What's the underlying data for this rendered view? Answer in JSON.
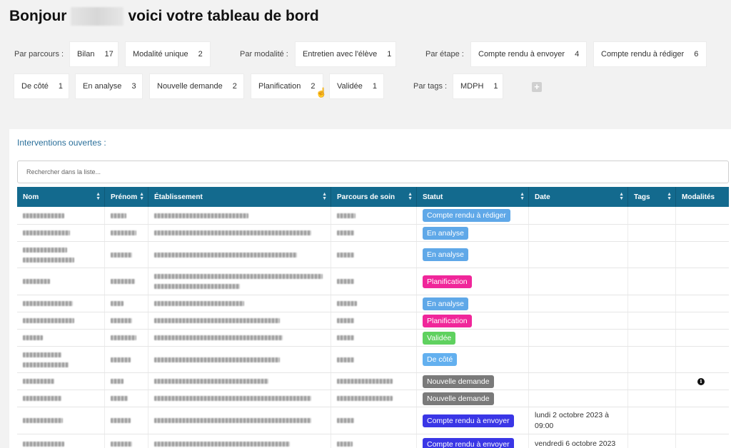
{
  "header": {
    "greeting": "Bonjour",
    "subtitle": "voici votre tableau de bord"
  },
  "filters": {
    "parcours_label": "Par parcours :",
    "modalite_label": "Par modalité :",
    "etape_label": "Par étape :",
    "tags_label": "Par tags :",
    "chips": [
      {
        "label": "Bilan",
        "count": "17"
      },
      {
        "label": "Modalité unique",
        "count": "2"
      },
      {
        "label": "Entretien avec l'élève",
        "count": "1"
      },
      {
        "label": "Compte rendu à envoyer",
        "count": "4"
      },
      {
        "label": "Compte rendu à rédiger",
        "count": "6"
      },
      {
        "label": "De côté",
        "count": "1"
      },
      {
        "label": "En analyse",
        "count": "3"
      },
      {
        "label": "Nouvelle demande",
        "count": "2"
      },
      {
        "label": "Planification",
        "count": "2"
      },
      {
        "label": "Validée",
        "count": "1"
      },
      {
        "label": "MDPH",
        "count": "1"
      }
    ],
    "add_tag": "+"
  },
  "panel": {
    "title": "Interventions ouvertes :",
    "search_placeholder": "Rechercher dans la liste..."
  },
  "table": {
    "columns": [
      "Nom",
      "Prénom",
      "Établissement",
      "Parcours de soin",
      "Statut",
      "Date",
      "Tags",
      "Modalités"
    ],
    "rows": [
      {
        "statut": "Compte rendu à rédiger",
        "color": "#5fa8e8",
        "date": ""
      },
      {
        "statut": "En analyse",
        "color": "#5fa8e8",
        "date": ""
      },
      {
        "statut": "En analyse",
        "color": "#5fa8e8",
        "date": ""
      },
      {
        "statut": "Planification",
        "color": "#f0269a",
        "date": ""
      },
      {
        "statut": "En analyse",
        "color": "#5fa8e8",
        "date": ""
      },
      {
        "statut": "Planification",
        "color": "#f0269a",
        "date": ""
      },
      {
        "statut": "Validée",
        "color": "#5fd15f",
        "date": ""
      },
      {
        "statut": "De côté",
        "color": "#63b0ef",
        "date": ""
      },
      {
        "statut": "Nouvelle demande",
        "color": "#7a7a7a",
        "date": ""
      },
      {
        "statut": "Nouvelle demande",
        "color": "#7a7a7a",
        "date": ""
      },
      {
        "statut": "Compte rendu à envoyer",
        "color": "#3a36e6",
        "date": "lundi 2 octobre 2023 à 09:00"
      },
      {
        "statut": "Compte rendu à envoyer",
        "color": "#3a36e6",
        "date": "vendredi 6 octobre 2023"
      }
    ]
  }
}
